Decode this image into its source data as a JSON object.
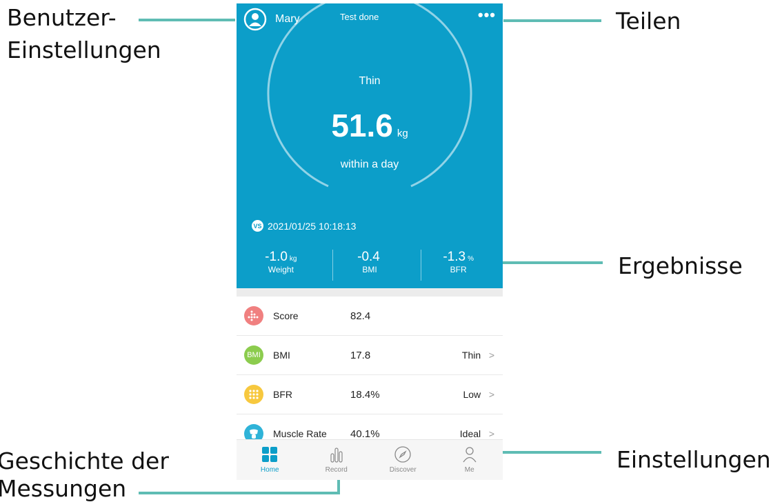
{
  "annotations": {
    "user_settings": "Benutzer-",
    "user_settings_2": "Einstellungen",
    "share": "Teilen",
    "results": "Ergebnisse",
    "history": "Geschichte der",
    "history_2": "Messungen",
    "settings": "Einstellungen"
  },
  "header": {
    "user_name": "Mary",
    "status": "Test done",
    "more_icon": "more-dots-icon"
  },
  "hero": {
    "status_word": "Thin",
    "weight": "51.6",
    "weight_unit": "kg",
    "period": "within a day",
    "compare_badge": "VS",
    "compare_datetime": "2021/01/25 10:18:13",
    "background_color": "#0c9ec9"
  },
  "diffs": [
    {
      "value": "-1.0",
      "unit": "kg",
      "label": "Weight"
    },
    {
      "value": "-0.4",
      "unit": "",
      "label": "BMI"
    },
    {
      "value": "-1.3",
      "unit": "%",
      "label": "BFR"
    }
  ],
  "metrics": [
    {
      "name": "Score",
      "value": "82.4",
      "level": "",
      "arrow": "",
      "icon": "score-icon",
      "color": "#f08080",
      "icon_text": ""
    },
    {
      "name": "BMI",
      "value": "17.8",
      "level": "Thin",
      "arrow": ">",
      "icon": "bmi-icon",
      "color": "#8ccc4e",
      "icon_text": "BMI"
    },
    {
      "name": "BFR",
      "value": "18.4%",
      "level": "Low",
      "arrow": ">",
      "icon": "bfr-icon",
      "color": "#f7c83e",
      "icon_text": ""
    },
    {
      "name": "Muscle Rate",
      "value": "40.1%",
      "level": "Ideal",
      "arrow": ">",
      "icon": "muscle-icon",
      "color": "#2fb3d8",
      "icon_text": ""
    }
  ],
  "tabs": [
    {
      "label": "Home",
      "icon": "home-icon",
      "active": true
    },
    {
      "label": "Record",
      "icon": "record-icon",
      "active": false
    },
    {
      "label": "Discover",
      "icon": "compass-icon",
      "active": false
    },
    {
      "label": "Me",
      "icon": "person-icon",
      "active": false
    }
  ],
  "colors": {
    "annotation_line": "#5fbcb4",
    "accent": "#0c9ec9"
  }
}
